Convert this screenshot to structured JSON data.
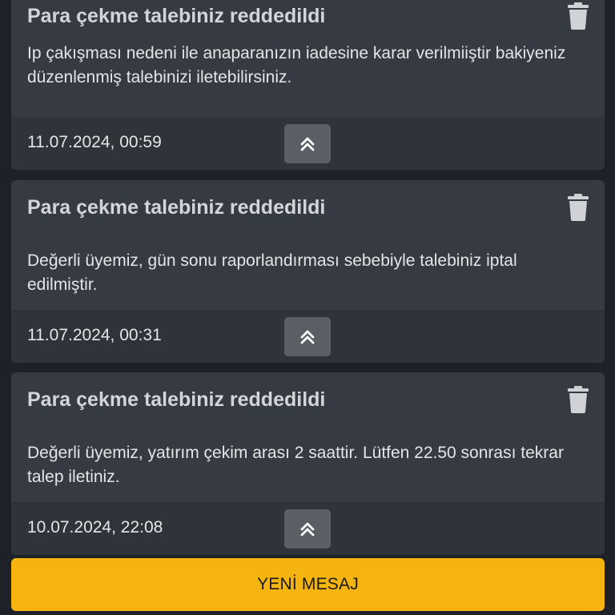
{
  "notifications": [
    {
      "title": "Para çekme talebiniz reddedildi",
      "message": "Ip çakışması nedeni ile anaparanızın iadesine karar verilmiiştir bakiyeniz düzenlenmiş talebinizi iletebilirsiniz.",
      "date": "11.07.2024, 00:59",
      "delete_icon": "trash-icon",
      "collapse_icon": "chevron-double-up-icon"
    },
    {
      "title": "Para çekme talebiniz reddedildi",
      "message": "Değerli üyemiz, gün sonu raporlandırması sebebiyle talebiniz iptal edilmiştir.",
      "date": "11.07.2024, 00:31",
      "delete_icon": "trash-icon",
      "collapse_icon": "chevron-double-up-icon"
    },
    {
      "title": "Para çekme talebiniz reddedildi",
      "message": "Değerli üyemiz, yatırım çekim arası 2 saattir. Lütfen 22.50 sonrası tekrar talep iletiniz.",
      "date": "10.07.2024, 22:08",
      "delete_icon": "trash-icon",
      "collapse_icon": "chevron-double-up-icon"
    }
  ],
  "new_message_button": {
    "label": "YENİ MESAJ"
  },
  "colors": {
    "background": "#1e2228",
    "card": "#363b43",
    "card_footer": "#2f343b",
    "accent": "#f5b40f",
    "icon": "#d0d2d6"
  }
}
